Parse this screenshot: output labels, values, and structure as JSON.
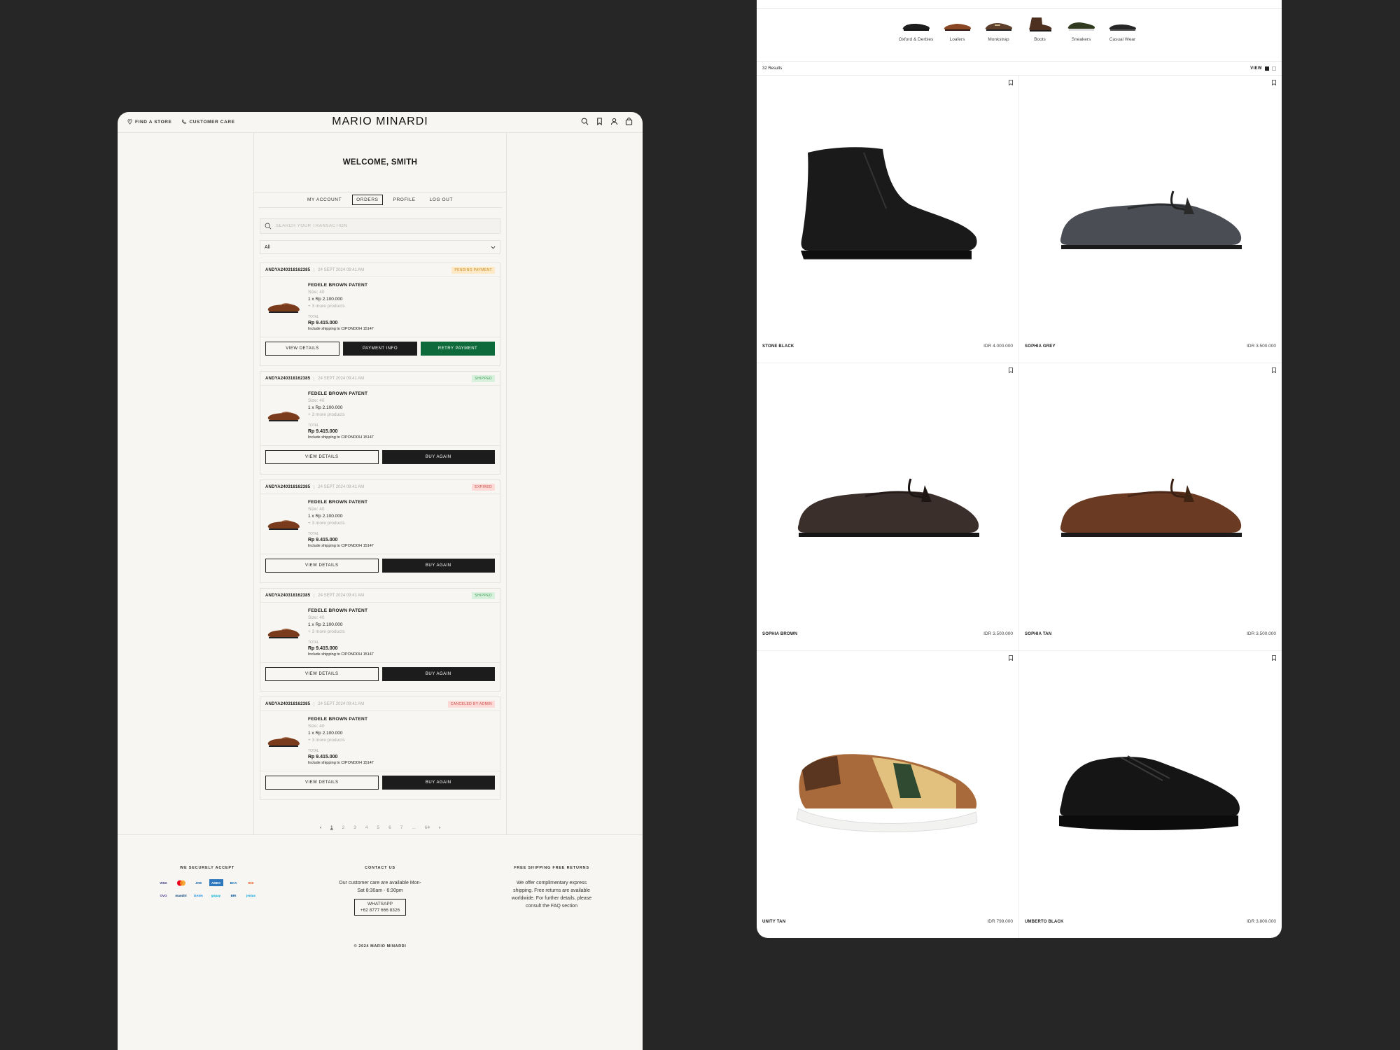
{
  "header": {
    "find_store": "FIND A STORE",
    "customer_care": "CUSTOMER CARE",
    "logo": "MARIO MINARDI"
  },
  "account": {
    "welcome": "WELCOME, SMITH",
    "tabs": [
      "MY ACCOUNT",
      "ORDERS",
      "PROFILE",
      "LOG OUT"
    ],
    "active_tab": "ORDERS",
    "search_placeholder": "SEARCH YOUR TRANSACTION",
    "filter_value": "All"
  },
  "orders": [
    {
      "id": "ANDYA240318162385",
      "date": "24 SEPT 2024 09:41 AM",
      "status": "PENDING PAYMENT",
      "product": "FEDELE BROWN PATENT",
      "size": "Size: 40",
      "qty_line": "1  x  Rp 2.100.000",
      "more": "+ 3 more products",
      "total_label": "TOTAL",
      "total": "Rp 9.415.000",
      "shipping": "Include shipping to CIPONDOH 15147",
      "actions": [
        "VIEW DETAILS",
        "PAYMENT INFO",
        "RETRY PAYMENT"
      ]
    },
    {
      "id": "ANDYA240318162385",
      "date": "24 SEPT 2024 09:41 AM",
      "status": "SHIPPED",
      "product": "FEDELE BROWN PATENT",
      "size": "Size: 40",
      "qty_line": "1  x  Rp 2.100.000",
      "more": "+ 3 more products",
      "total_label": "TOTAL",
      "total": "Rp 9.415.000",
      "shipping": "Include shipping to CIPONDOH 15147",
      "actions": [
        "VIEW DETAILS",
        "BUY AGAIN"
      ]
    },
    {
      "id": "ANDYA240318162385",
      "date": "24 SEPT 2024 09:41 AM",
      "status": "EXPIRED",
      "product": "FEDELE BROWN PATENT",
      "size": "Size: 40",
      "qty_line": "1  x  Rp 2.100.000",
      "more": "+ 3 more products",
      "total_label": "TOTAL",
      "total": "Rp 9.415.000",
      "shipping": "Include shipping to CIPONDOH 15147",
      "actions": [
        "VIEW DETAILS",
        "BUY AGAIN"
      ]
    },
    {
      "id": "ANDYA240318162385",
      "date": "24 SEPT 2024 09:41 AM",
      "status": "SHIPPED",
      "product": "FEDELE BROWN PATENT",
      "size": "Size: 40",
      "qty_line": "1  x  Rp 2.100.000",
      "more": "+ 3 more products",
      "total_label": "TOTAL",
      "total": "Rp 9.415.000",
      "shipping": "Include shipping to CIPONDOH 15147",
      "actions": [
        "VIEW DETAILS",
        "BUY AGAIN"
      ]
    },
    {
      "id": "ANDYA240318162385",
      "date": "24 SEPT 2024 09:41 AM",
      "status": "CANCELED BY ADMIN",
      "product": "FEDELE BROWN PATENT",
      "size": "Size: 40",
      "qty_line": "1  x  Rp 2.100.000",
      "more": "+ 3 more products",
      "total_label": "TOTAL",
      "total": "Rp 9.415.000",
      "shipping": "Include shipping to CIPONDOH 15147",
      "actions": [
        "VIEW DETAILS",
        "BUY AGAIN"
      ]
    }
  ],
  "pagination": {
    "prev": "‹",
    "pages": [
      "1",
      "2",
      "3",
      "4",
      "5",
      "6",
      "7",
      "...",
      "64"
    ],
    "current": "1",
    "next": "›"
  },
  "footer": {
    "accept_title": "WE SECURELY ACCEPT",
    "payment_methods": [
      "VISA",
      "MC",
      "JCB",
      "AMEX",
      "BCA",
      "BNI",
      "OVO",
      "mandiri",
      "DANA",
      "gopay",
      "BRI",
      "jenius"
    ],
    "contact_title": "CONTACT US",
    "contact_text": "Our customer care are available Mon-Sat 8:30am - 6:30pm",
    "whatsapp_label": "WHATSAPP",
    "whatsapp_number": "+62 8777 666 8326",
    "shipping_title": "FREE SHIPPING FREE RETURNS",
    "shipping_text": "We offer complimentary express shipping. Free returns are available worldwide. For further details, please consult the FAQ section",
    "copyright": "© 2024 MARIO MINARDI"
  },
  "catalog": {
    "categories": [
      "Oxford & Derbies",
      "Loafers",
      "Monkstrap",
      "Boots",
      "Sneakers",
      "Casual Wear"
    ],
    "results": "32 Results",
    "view_label": "VIEW",
    "products": [
      {
        "name": "STONE BLACK",
        "price": "IDR 4.000.000",
        "kind": "boot",
        "color": "#1e1e1e"
      },
      {
        "name": "SOPHIA GREY",
        "price": "IDR 3.500.000",
        "kind": "loafer",
        "color": "#4a4d53"
      },
      {
        "name": "SOPHIA BROWN",
        "price": "IDR 3.500.000",
        "kind": "loafer",
        "color": "#3b2f2c"
      },
      {
        "name": "SOPHIA TAN",
        "price": "IDR 3.500.000",
        "kind": "loafer",
        "color": "#6a3a22"
      },
      {
        "name": "UNITY TAN",
        "price": "IDR 799.000",
        "kind": "sneaker",
        "color": "#a86a3a"
      },
      {
        "name": "UMBERTO BLACK",
        "price": "IDR 3.800.000",
        "kind": "sneaker-black",
        "color": "#151515"
      }
    ]
  }
}
